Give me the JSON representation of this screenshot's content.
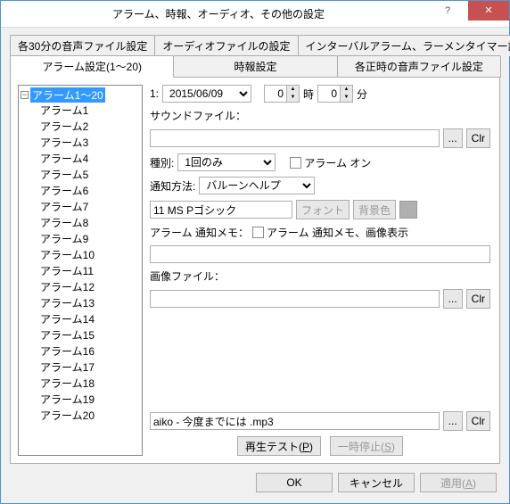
{
  "window": {
    "title": "アラーム、時報、オーディオ、その他の設定"
  },
  "titlebar": {
    "help": "?",
    "close": "✕"
  },
  "tabs": {
    "row1": [
      {
        "label": "各30分の音声ファイル設定"
      },
      {
        "label": "オーディオファイルの設定"
      },
      {
        "label": "インターバルアラーム、ラーメンタイマー設定"
      }
    ],
    "row2": [
      {
        "label": "アラーム設定(1〜20)",
        "active": true
      },
      {
        "label": "時報設定"
      },
      {
        "label": "各正時の音声ファイル設定"
      }
    ]
  },
  "tree": {
    "root": "アラーム1〜20",
    "expander": "−",
    "items": [
      "アラーム1",
      "アラーム2",
      "アラーム3",
      "アラーム4",
      "アラーム5",
      "アラーム6",
      "アラーム7",
      "アラーム8",
      "アラーム9",
      "アラーム10",
      "アラーム11",
      "アラーム12",
      "アラーム13",
      "アラーム14",
      "アラーム15",
      "アラーム16",
      "アラーム17",
      "アラーム18",
      "アラーム19",
      "アラーム20"
    ]
  },
  "form": {
    "index_label": "1:",
    "date": "2015/06/09",
    "hour": "0",
    "hour_suffix": "時",
    "minute": "0",
    "minute_suffix": "分",
    "soundfile_label": "サウンドファイル：",
    "browse": "...",
    "clr": "Clr",
    "type_label": "種別:",
    "type_value": "1回のみ",
    "alarm_on": "アラーム オン",
    "notify_label": "通知方法:",
    "notify_value": "バルーンヘルプ",
    "font_sample": "11 MS Pゴシック",
    "font_btn": "フォント",
    "bgcolor_btn": "背景色",
    "memo_label": "アラーム 通知メモ：",
    "memo_chk": "アラーム 通知メモ、画像表示",
    "image_label": "画像ファイル：",
    "audio_value": "aiko - 今度までには .mp3",
    "play_btn": "再生テスト(",
    "play_key": "P",
    "play_btn_end": ")",
    "pause_btn": "一時停止(",
    "pause_key": "S",
    "pause_btn_end": ")"
  },
  "footer": {
    "ok": "OK",
    "cancel": "キャンセル",
    "apply_pre": "適用(",
    "apply_key": "A",
    "apply_end": ")"
  }
}
